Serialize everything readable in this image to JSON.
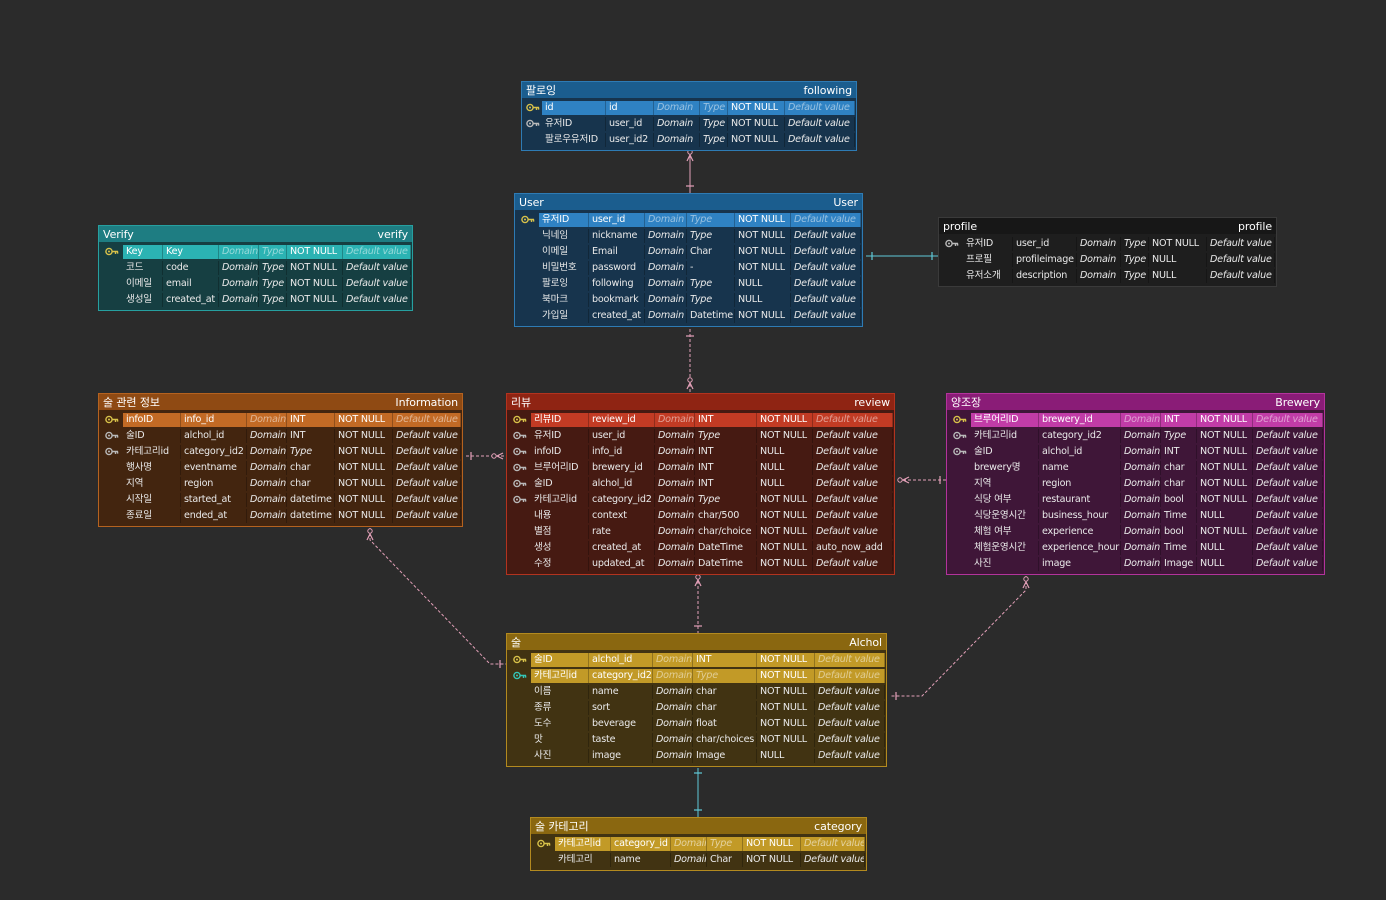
{
  "placeholders": {
    "domain": "Domain",
    "type": "Type",
    "default": "Default value"
  },
  "tables": [
    {
      "id": "following",
      "title_ko": "팔로잉",
      "title_en": "following",
      "theme": {
        "border": "#2e7bb4",
        "header": "#1b5d8e",
        "body": "#17344d",
        "hl": "#2f82c3",
        "key": "#d8c24a"
      },
      "rows": [
        {
          "key": "pk",
          "label": "id",
          "column": "id",
          "domain": "",
          "type": "",
          "nn": "NOT NULL",
          "def": ""
        },
        {
          "key": "fk",
          "label": "유저ID",
          "column": "user_id",
          "domain": "",
          "type": "",
          "nn": "NOT NULL",
          "def": ""
        },
        {
          "key": "",
          "label": "팔로우유저ID",
          "column": "user_id2",
          "domain": "",
          "type": "",
          "nn": "NOT NULL",
          "def": ""
        }
      ]
    },
    {
      "id": "user",
      "title_ko": "User",
      "title_en": "User",
      "theme": {
        "border": "#2e7bb4",
        "header": "#1b5d8e",
        "body": "#17344d",
        "hl": "#2f82c3",
        "key": "#d8c24a"
      },
      "rows": [
        {
          "key": "pk",
          "label": "유저ID",
          "column": "user_id",
          "domain": "",
          "type": "",
          "nn": "NOT NULL",
          "def": ""
        },
        {
          "key": "",
          "label": "닉네임",
          "column": "nickname",
          "domain": "",
          "type": "",
          "nn": "NOT NULL",
          "def": ""
        },
        {
          "key": "",
          "label": "이메일",
          "column": "Email",
          "domain": "",
          "type": "Char",
          "nn": "NOT NULL",
          "def": ""
        },
        {
          "key": "",
          "label": "비밀번호",
          "column": "password",
          "domain": "",
          "type": "-",
          "nn": "NOT NULL",
          "def": ""
        },
        {
          "key": "",
          "label": "팔로잉",
          "column": "following",
          "domain": "",
          "type": "",
          "nn": "NULL",
          "def": ""
        },
        {
          "key": "",
          "label": "북마크",
          "column": "bookmark",
          "domain": "",
          "type": "",
          "nn": "NULL",
          "def": ""
        },
        {
          "key": "",
          "label": "가입일",
          "column": "created_at",
          "domain": "",
          "type": "Datetime",
          "nn": "NOT NULL",
          "def": ""
        }
      ]
    },
    {
      "id": "verify",
      "title_ko": "Verify",
      "title_en": "verify",
      "theme": {
        "border": "#26a0a0",
        "header": "#1e7d82",
        "body": "#163f42",
        "hl": "#2bb3b3",
        "key": "#d8c24a"
      },
      "rows": [
        {
          "key": "pk",
          "label": "Key",
          "column": "Key",
          "domain": "",
          "type": "",
          "nn": "NOT NULL",
          "def": ""
        },
        {
          "key": "",
          "label": "코드",
          "column": "code",
          "domain": "",
          "type": "",
          "nn": "NOT NULL",
          "def": ""
        },
        {
          "key": "",
          "label": "이메일",
          "column": "email",
          "domain": "",
          "type": "",
          "nn": "NOT NULL",
          "def": ""
        },
        {
          "key": "",
          "label": "생성일",
          "column": "created_at",
          "domain": "",
          "type": "",
          "nn": "NOT NULL",
          "def": ""
        }
      ]
    },
    {
      "id": "profile",
      "title_ko": "profile",
      "title_en": "profile",
      "theme": {
        "border": "#3a3a3a",
        "header": "#171717",
        "body": "#1e1e1e",
        "hl": "#2e2e2e",
        "key": "#34c7b8"
      },
      "rows": [
        {
          "key": "fk",
          "label": "유저ID",
          "column": "user_id",
          "domain": "",
          "type": "",
          "nn": "NOT NULL",
          "def": ""
        },
        {
          "key": "",
          "label": "프로필",
          "column": "profileimage",
          "domain": "",
          "type": "",
          "nn": "NULL",
          "def": ""
        },
        {
          "key": "",
          "label": "유저소개",
          "column": "description",
          "domain": "",
          "type": "",
          "nn": "NULL",
          "def": ""
        }
      ]
    },
    {
      "id": "information",
      "title_ko": "술 관련 정보",
      "title_en": "Information",
      "theme": {
        "border": "#b5621f",
        "header": "#8f4a13",
        "body": "#43250f",
        "hl": "#c26a25",
        "key": "#d8c24a"
      },
      "rows": [
        {
          "key": "pk",
          "label": "infoID",
          "column": "info_id",
          "domain": "",
          "type": "INT",
          "nn": "NOT NULL",
          "def": ""
        },
        {
          "key": "fk",
          "label": "술ID",
          "column": "alchol_id",
          "domain": "",
          "type": "INT",
          "nn": "NOT NULL",
          "def": ""
        },
        {
          "key": "fk",
          "label": "카테고리id",
          "column": "category_id2",
          "domain": "",
          "type": "",
          "nn": "NOT NULL",
          "def": ""
        },
        {
          "key": "",
          "label": "행사명",
          "column": "eventname",
          "domain": "",
          "type": "char",
          "nn": "NOT NULL",
          "def": ""
        },
        {
          "key": "",
          "label": "지역",
          "column": "region",
          "domain": "",
          "type": "char",
          "nn": "NOT NULL",
          "def": ""
        },
        {
          "key": "",
          "label": "시작일",
          "column": "started_at",
          "domain": "",
          "type": "datetime",
          "nn": "NOT NULL",
          "def": ""
        },
        {
          "key": "",
          "label": "종료일",
          "column": "ended_at",
          "domain": "",
          "type": "datetime",
          "nn": "NOT NULL",
          "def": ""
        }
      ]
    },
    {
      "id": "review",
      "title_ko": "리뷰",
      "title_en": "review",
      "theme": {
        "border": "#b3331f",
        "header": "#8f2413",
        "body": "#461a12",
        "hl": "#c23b24",
        "key": "#d8c24a"
      },
      "rows": [
        {
          "key": "pk",
          "label": "리뷰ID",
          "column": "review_id",
          "domain": "",
          "type": "INT",
          "nn": "NOT NULL",
          "def": ""
        },
        {
          "key": "fk",
          "label": "유저ID",
          "column": "user_id",
          "domain": "",
          "type": "",
          "nn": "NOT NULL",
          "def": ""
        },
        {
          "key": "fk",
          "label": "infoID",
          "column": "info_id",
          "domain": "",
          "type": "INT",
          "nn": "NULL",
          "def": ""
        },
        {
          "key": "fk",
          "label": "브루어리ID",
          "column": "brewery_id",
          "domain": "",
          "type": "INT",
          "nn": "NULL",
          "def": ""
        },
        {
          "key": "fk",
          "label": "술ID",
          "column": "alchol_id",
          "domain": "",
          "type": "INT",
          "nn": "NULL",
          "def": ""
        },
        {
          "key": "fk",
          "label": "카테고리id",
          "column": "category_id2",
          "domain": "",
          "type": "",
          "nn": "NOT NULL",
          "def": ""
        },
        {
          "key": "",
          "label": "내용",
          "column": "context",
          "domain": "",
          "type": "char/500",
          "nn": "NOT NULL",
          "def": ""
        },
        {
          "key": "",
          "label": "별점",
          "column": "rate",
          "domain": "",
          "type": "char/choice",
          "nn": "NOT NULL",
          "def": ""
        },
        {
          "key": "",
          "label": "생성",
          "column": "created_at",
          "domain": "",
          "type": "DateTime",
          "nn": "NOT NULL",
          "def": "auto_now_add"
        },
        {
          "key": "",
          "label": "수정",
          "column": "updated_at",
          "domain": "",
          "type": "DateTime",
          "nn": "NOT NULL",
          "def": ""
        }
      ]
    },
    {
      "id": "brewery",
      "title_ko": "양조장",
      "title_en": "Brewery",
      "theme": {
        "border": "#b3339c",
        "header": "#8a1c77",
        "body": "#3f1638",
        "hl": "#c13ca7",
        "key": "#d8c24a"
      },
      "rows": [
        {
          "key": "pk",
          "label": "브루어리ID",
          "column": "brewery_id",
          "domain": "",
          "type": "INT",
          "nn": "NOT NULL",
          "def": ""
        },
        {
          "key": "fk",
          "label": "카테고리id",
          "column": "category_id2",
          "domain": "",
          "type": "",
          "nn": "NOT NULL",
          "def": ""
        },
        {
          "key": "fk",
          "label": "술ID",
          "column": "alchol_id",
          "domain": "",
          "type": "INT",
          "nn": "NOT NULL",
          "def": ""
        },
        {
          "key": "",
          "label": "brewery명",
          "column": "name",
          "domain": "",
          "type": "char",
          "nn": "NOT NULL",
          "def": ""
        },
        {
          "key": "",
          "label": "지역",
          "column": "region",
          "domain": "",
          "type": "char",
          "nn": "NOT NULL",
          "def": ""
        },
        {
          "key": "",
          "label": "식당 여부",
          "column": "restaurant",
          "domain": "",
          "type": "bool",
          "nn": "NOT NULL",
          "def": ""
        },
        {
          "key": "",
          "label": "식당운영시간",
          "column": "business_hour",
          "domain": "",
          "type": "Time",
          "nn": "NULL",
          "def": ""
        },
        {
          "key": "",
          "label": "체험 여부",
          "column": "experience",
          "domain": "",
          "type": "bool",
          "nn": "NOT NULL",
          "def": ""
        },
        {
          "key": "",
          "label": "체험운영시간",
          "column": "experience_hour",
          "domain": "",
          "type": "Time",
          "nn": "NULL",
          "def": ""
        },
        {
          "key": "",
          "label": "사진",
          "column": "image",
          "domain": "",
          "type": "Image",
          "nn": "NULL",
          "def": ""
        }
      ]
    },
    {
      "id": "alchol",
      "title_ko": "술",
      "title_en": "Alchol",
      "theme": {
        "border": "#b38a1f",
        "header": "#8a6710",
        "body": "#413312",
        "hl": "#c29a27",
        "key": "#d8c24a"
      },
      "rows": [
        {
          "key": "pk",
          "label": "술ID",
          "column": "alchol_id",
          "domain": "",
          "type": "INT",
          "nn": "NOT NULL",
          "def": ""
        },
        {
          "key": "pkfk",
          "label": "카테고리id",
          "column": "category_id2",
          "domain": "",
          "type": "",
          "nn": "NOT NULL",
          "def": ""
        },
        {
          "key": "",
          "label": "이름",
          "column": "name",
          "domain": "",
          "type": "char",
          "nn": "NOT NULL",
          "def": ""
        },
        {
          "key": "",
          "label": "종류",
          "column": "sort",
          "domain": "",
          "type": "char",
          "nn": "NOT NULL",
          "def": ""
        },
        {
          "key": "",
          "label": "도수",
          "column": "beverage",
          "domain": "",
          "type": "float",
          "nn": "NOT NULL",
          "def": ""
        },
        {
          "key": "",
          "label": "맛",
          "column": "taste",
          "domain": "",
          "type": "char/choices",
          "nn": "NOT NULL",
          "def": ""
        },
        {
          "key": "",
          "label": "사진",
          "column": "image",
          "domain": "",
          "type": "Image",
          "nn": "NULL",
          "def": ""
        }
      ]
    },
    {
      "id": "category",
      "title_ko": "술 카테고리",
      "title_en": "category",
      "theme": {
        "border": "#b38a1f",
        "header": "#8a6710",
        "body": "#413312",
        "hl": "#c29a27",
        "key": "#d8c24a"
      },
      "rows": [
        {
          "key": "pk",
          "label": "카테고리id",
          "column": "category_id",
          "domain": "Domain",
          "type": "Type",
          "nn": "NOT NULL",
          "def": "Default value"
        },
        {
          "key": "",
          "label": "카테고리",
          "column": "name",
          "domain": "",
          "type": "Char",
          "nn": "NOT NULL",
          "def": ""
        }
      ]
    }
  ],
  "relations": [
    {
      "name": "following-user",
      "color": "#e3a0b8"
    },
    {
      "name": "user-review",
      "color": "#e3a0b8"
    },
    {
      "name": "user-profile",
      "color": "#5fc9d8"
    },
    {
      "name": "information-review",
      "color": "#e3a0b8"
    },
    {
      "name": "brewery-review",
      "color": "#e3a0b8"
    },
    {
      "name": "review-alchol",
      "color": "#e3a0b8"
    },
    {
      "name": "information-alchol",
      "color": "#e3a0b8"
    },
    {
      "name": "brewery-alchol",
      "color": "#e3a0b8"
    },
    {
      "name": "alchol-category",
      "color": "#5fc9d8"
    }
  ]
}
